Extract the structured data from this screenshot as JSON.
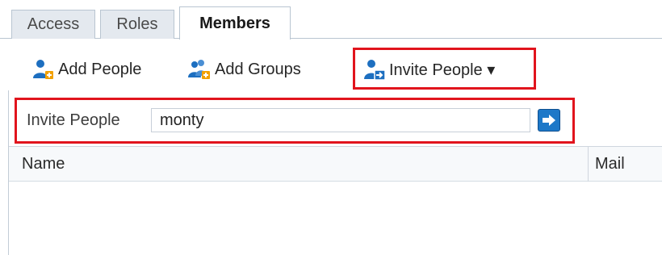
{
  "tabs": [
    {
      "label": "Access",
      "selected": false
    },
    {
      "label": "Roles",
      "selected": false
    },
    {
      "label": "Members",
      "selected": true
    }
  ],
  "toolbar": {
    "add_people": {
      "label": "Add People",
      "icon": "add-person-icon"
    },
    "add_groups": {
      "label": "Add Groups",
      "icon": "add-group-icon"
    },
    "invite_people": {
      "label": "Invite People ▾",
      "icon": "invite-person-icon"
    }
  },
  "invite": {
    "label": "Invite People",
    "value": "monty",
    "go_icon": "arrow-right-icon"
  },
  "table": {
    "columns": [
      "Name",
      "Mail"
    ],
    "rows": []
  },
  "colors": {
    "highlight": "#e1141d",
    "icon_blue": "#1d6fc0",
    "button_blue": "#1d78c8"
  }
}
